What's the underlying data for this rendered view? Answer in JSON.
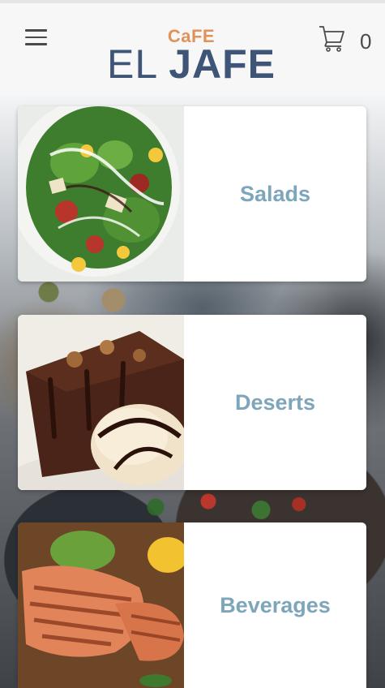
{
  "header": {
    "menu_icon": "hamburger-menu-icon",
    "logo": {
      "top_text": "CaFE",
      "main_light": "EL ",
      "main_bold": "JAFE"
    },
    "cart": {
      "icon": "shopping-cart-icon",
      "count": "0"
    }
  },
  "categories": [
    {
      "label": "Salads",
      "image": "salad-photo"
    },
    {
      "label": "Deserts",
      "image": "chocolate-cake-photo"
    },
    {
      "label": "Beverages",
      "image": "grilled-salmon-photo"
    }
  ],
  "colors": {
    "label": "#7ea6bb",
    "logo_orange": "#e0925a",
    "logo_navy": "#3f5578"
  }
}
